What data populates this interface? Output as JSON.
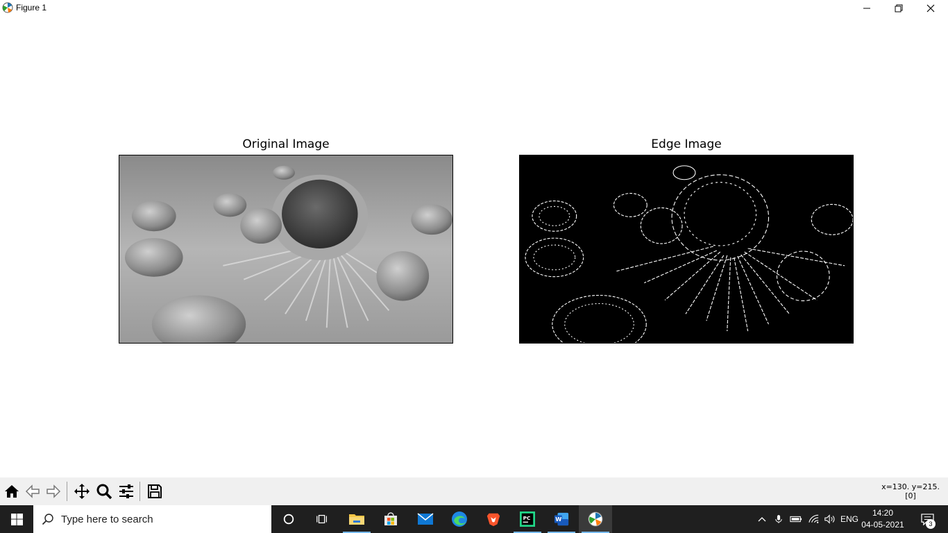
{
  "window": {
    "title": "Figure 1",
    "icon": "matplotlib-icon",
    "controls": [
      "minimize-icon",
      "restore-icon",
      "close-icon"
    ]
  },
  "figure": {
    "subplots": [
      {
        "title": "Original Image",
        "image": "grayscale-cancer-cell-image"
      },
      {
        "title": "Edge Image",
        "image": "canny-edge-image"
      }
    ]
  },
  "toolbar": {
    "buttons": [
      "home-icon",
      "back-icon",
      "forward-icon",
      "pan-icon",
      "zoom-icon",
      "configure-subplots-icon",
      "save-icon"
    ],
    "coords_line1": "x=130. y=215.",
    "coords_line2": "[0]"
  },
  "taskbar": {
    "search_placeholder": "Type here to search",
    "apps": [
      "cortana-icon",
      "task-view-icon",
      "file-explorer-icon",
      "microsoft-store-icon",
      "mail-icon",
      "edge-icon",
      "brave-icon",
      "pycharm-icon",
      "word-icon",
      "matplotlib-icon"
    ],
    "language": "ENG",
    "time": "14:20",
    "date": "04-05-2021",
    "notification_count": "3"
  },
  "colors": {
    "taskbar_bg": "#1f1f1f",
    "toolbar_bg": "#f0f0f0",
    "running_indicator": "#76b9ed"
  }
}
